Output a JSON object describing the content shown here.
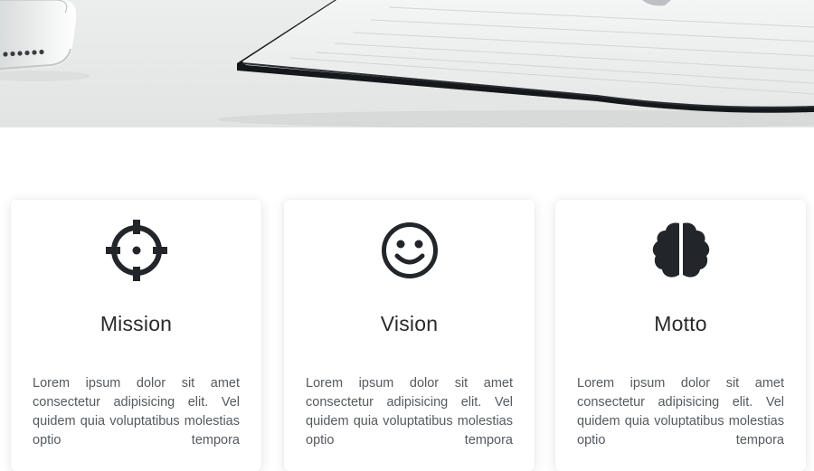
{
  "cards": [
    {
      "title": "Mission",
      "icon": "crosshair-icon",
      "text": "Lorem ipsum dolor sit amet consectetur adipisicing elit. Vel quidem quia voluptatibus molestias optio tempora"
    },
    {
      "title": "Vision",
      "icon": "smiley-face-icon",
      "text": "Lorem ipsum dolor sit amet consectetur adipisicing elit. Vel quidem quia voluptatibus molestias optio tempora"
    },
    {
      "title": "Motto",
      "icon": "brain-icon",
      "text": "Lorem ipsum dolor sit amet consectetur adipisicing elit. Vel quidem quia voluptatibus molestias optio tempora"
    }
  ],
  "colors": {
    "icon": "#222529",
    "title": "#2a2a2a",
    "text": "#555a5f"
  }
}
